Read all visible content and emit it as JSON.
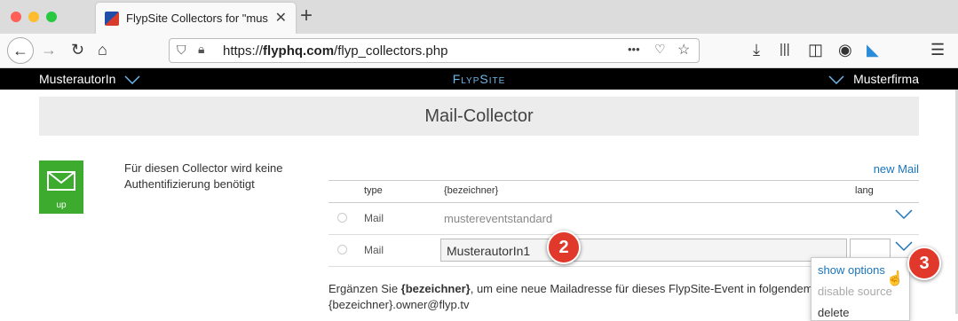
{
  "browser": {
    "tab_title": "FlypSite Collectors for \"musterf",
    "url_prefix": "https://",
    "url_domain": "flyphq.com",
    "url_path": "/flyp_collectors.php",
    "url_more": "•••",
    "new_tab": "+",
    "tab_close": "✕"
  },
  "header": {
    "user": "MusterautorIn",
    "brand": "FlypSite",
    "firm": "Musterfirma"
  },
  "page": {
    "title": "Mail-Collector",
    "mail_icon_label": "up",
    "description": "Für diesen Collector wird keine Authentifizierung benötigt",
    "new_mail": "new Mail"
  },
  "table": {
    "col_type": "type",
    "col_name": "{bezeichner}",
    "col_lang": "lang",
    "rows": [
      {
        "type": "Mail",
        "name": "mustereventstandard"
      },
      {
        "type": "Mail",
        "name": "MusterautorIn1"
      }
    ]
  },
  "menu": {
    "show_options": "show options",
    "disable_source": "disable source",
    "delete": "delete"
  },
  "badges": {
    "two": "2",
    "three": "3"
  },
  "help": {
    "prefix": "Ergänzen Sie ",
    "bold": "{bezeichner}",
    "suffix": ", um eine neue Mailadresse für dieses FlypSite-Event in folgendem",
    "line2": "{bezeichner}.owner@flyp.tv"
  },
  "colors": {
    "accent": "#1a75bb",
    "badge": "#e0382a",
    "mail_green": "#3cab2e",
    "brand": "#6fb6e8"
  }
}
